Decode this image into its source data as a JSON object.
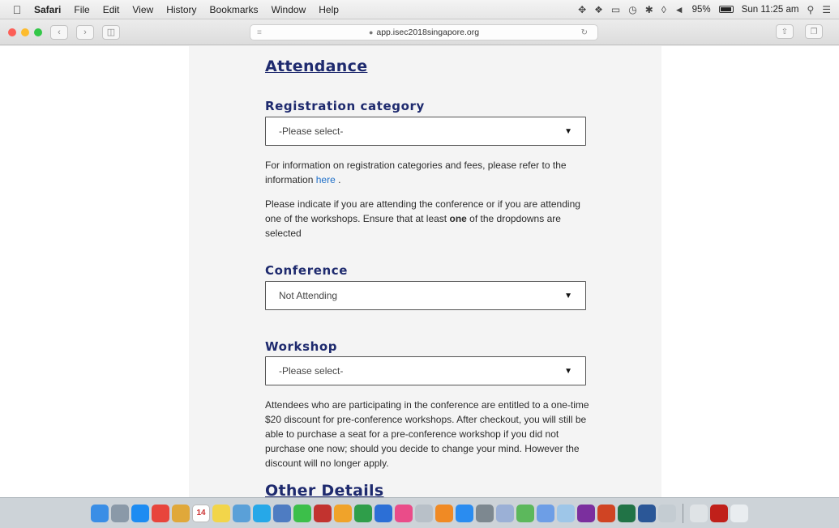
{
  "menubar": {
    "app_name": "Safari",
    "items": [
      "File",
      "Edit",
      "View",
      "History",
      "Bookmarks",
      "Window",
      "Help"
    ],
    "battery": "95%",
    "clock": "Sun 11:25 am"
  },
  "browser": {
    "url": "app.isec2018singapore.org"
  },
  "page": {
    "section_title": "Attendance",
    "registration": {
      "title": "Registration category",
      "selected": "-Please select-",
      "info_text": "For information on registration categories and fees, please refer to the information",
      "info_link": "here",
      "info_end": "."
    },
    "instruction": {
      "text_before": "Please indicate if you are attending the conference or if you are attending one of the workshops. Ensure that at least",
      "bold": "one",
      "text_after": "of the dropdowns are selected"
    },
    "conference": {
      "title": "Conference",
      "selected": "Not Attending"
    },
    "workshop": {
      "title": "Workshop",
      "selected": "-Please select-",
      "note": "Attendees who are participating in the conference are entitled to a one-time $20 discount for pre-conference workshops. After checkout, you will still be able to purchase a seat for a pre-conference workshop if you did not purchase one now; should you decide to change your mind. However the discount will no longer apply."
    },
    "next_section_title": "Other Details"
  },
  "dock": {
    "calendar_day": "14",
    "icons": [
      {
        "name": "finder-icon",
        "color": "#3a8ee6"
      },
      {
        "name": "launchpad-icon",
        "color": "#8a99a8"
      },
      {
        "name": "safari-icon",
        "color": "#1d8cf2"
      },
      {
        "name": "chrome-icon",
        "color": "#e8453c"
      },
      {
        "name": "notes-folder-icon",
        "color": "#e0a83a"
      },
      {
        "name": "calendar-icon",
        "color": "#ffffff"
      },
      {
        "name": "stickies-icon",
        "color": "#f2d54a"
      },
      {
        "name": "preview-icon",
        "color": "#5aa0d8"
      },
      {
        "name": "skype-icon",
        "color": "#26a8e8"
      },
      {
        "name": "photo-browser-icon",
        "color": "#4e7cc2"
      },
      {
        "name": "facetime-icon",
        "color": "#3cbf4a"
      },
      {
        "name": "photo-booth-icon",
        "color": "#c2332f"
      },
      {
        "name": "photos-icon",
        "color": "#f0a32a"
      },
      {
        "name": "numbers-icon",
        "color": "#2f9e4a"
      },
      {
        "name": "keynote-icon",
        "color": "#2c6fd6"
      },
      {
        "name": "itunes-icon",
        "color": "#ea4c89"
      },
      {
        "name": "help-icon",
        "color": "#b8c0c8"
      },
      {
        "name": "ibooks-icon",
        "color": "#f08a24"
      },
      {
        "name": "app-store-icon",
        "color": "#2a8cf0"
      },
      {
        "name": "system-preferences-icon",
        "color": "#7d8890"
      },
      {
        "name": "photo-app-icon",
        "color": "#9bb0d6"
      },
      {
        "name": "maps-icon",
        "color": "#5cb85c"
      },
      {
        "name": "photo-viewer-icon",
        "color": "#6d9ee6"
      },
      {
        "name": "finder-window-icon",
        "color": "#9ec6e8"
      },
      {
        "name": "onenote-icon",
        "color": "#7b2f9e"
      },
      {
        "name": "powerpoint-icon",
        "color": "#d04423"
      },
      {
        "name": "excel-icon",
        "color": "#217346"
      },
      {
        "name": "word-icon",
        "color": "#2b5797"
      },
      {
        "name": "question-icon",
        "color": "#c4ccd2"
      },
      {
        "name": "documents-stack-icon",
        "color": "#dfe3e6"
      },
      {
        "name": "acrobat-icon",
        "color": "#c0201a"
      },
      {
        "name": "trash-icon",
        "color": "#e9edf0"
      }
    ]
  }
}
